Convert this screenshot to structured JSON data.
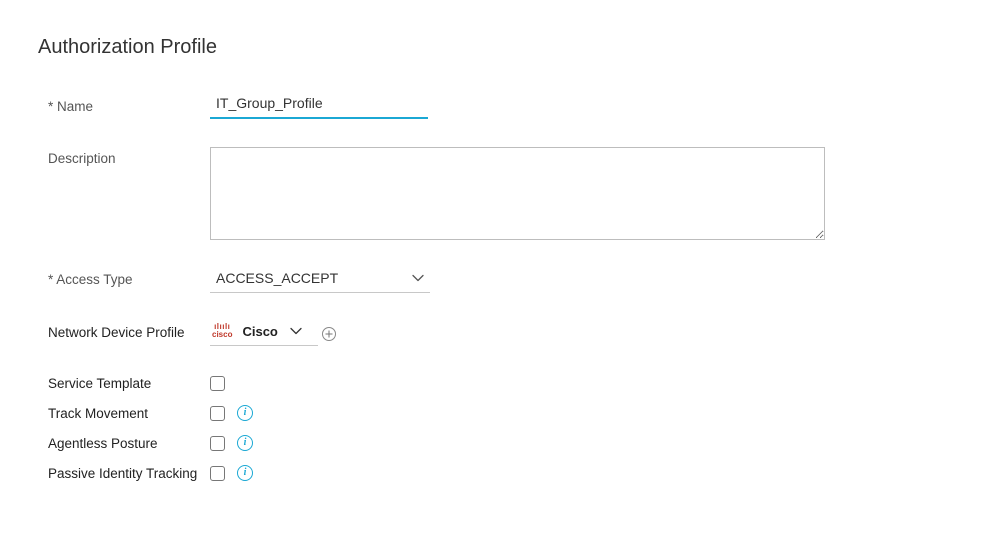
{
  "header": {
    "title": "Authorization Profile"
  },
  "form": {
    "name": {
      "label": "* Name",
      "value": "IT_Group_Profile"
    },
    "description": {
      "label": "Description",
      "value": ""
    },
    "access_type": {
      "label": "* Access Type",
      "selected": "ACCESS_ACCEPT"
    },
    "network_device_profile": {
      "label": "Network Device Profile",
      "vendor_logo": "cisco",
      "vendor_text": "Cisco"
    },
    "service_template": {
      "label": "Service Template",
      "checked": false
    },
    "track_movement": {
      "label": "Track Movement",
      "checked": false
    },
    "agentless_posture": {
      "label": "Agentless Posture",
      "checked": false
    },
    "passive_identity_tracking": {
      "label": "Passive Identity Tracking",
      "checked": false
    }
  }
}
